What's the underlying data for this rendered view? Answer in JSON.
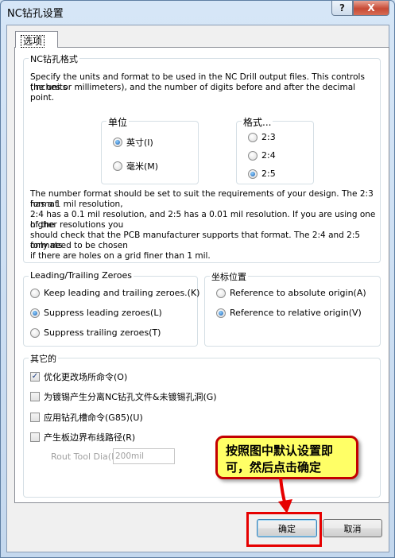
{
  "window": {
    "title": "NC钻孔设置"
  },
  "titlebar": {
    "help": "?",
    "close": "X"
  },
  "tabs": [
    {
      "label": "选项"
    }
  ],
  "format_group": {
    "title": "NC钻孔格式",
    "intro": [
      "Specify the units and format to be used in the NC Drill output files. This controls the units",
      "(inches or millimeters), and the number of digits before and after the decimal point."
    ],
    "units": {
      "title": "单位",
      "options": [
        {
          "label": "英寸(I)",
          "selected": true
        },
        {
          "label": "毫米(M)",
          "selected": false
        }
      ]
    },
    "format": {
      "title": "格式...",
      "options": [
        {
          "label": "2:3",
          "selected": false
        },
        {
          "label": "2:4",
          "selected": false
        },
        {
          "label": "2:5",
          "selected": true
        }
      ]
    },
    "note": [
      "The number format should be set to suit the requirements of your design. The 2:3 format",
      "has a 1 mil resolution,",
      "2:4 has a 0.1 mil resolution, and 2:5 has a 0.01 mil resolution. If you are using one of the",
      "higher resolutions you",
      "should check that the PCB manufacturer supports that format. The 2:4 and 2:5 formats",
      "only need to be chosen",
      "if there are holes on a grid finer than 1 mil."
    ]
  },
  "zeroes_group": {
    "title": "Leading/Trailing Zeroes",
    "options": [
      {
        "label": "Keep leading and trailing zeroes.(K)",
        "selected": false
      },
      {
        "label": "Suppress leading zeroes(L)",
        "selected": true
      },
      {
        "label": "Suppress trailing zeroes(T)",
        "selected": false
      }
    ]
  },
  "coord_group": {
    "title": "坐标位置",
    "options": [
      {
        "label": "Reference to absolute origin(A)",
        "selected": false
      },
      {
        "label": "Reference to relative origin(V)",
        "selected": true
      }
    ]
  },
  "other_group": {
    "title": "其它的",
    "checks": [
      {
        "label": "优化更改场所命令(O)",
        "checked": true
      },
      {
        "label": "为镀锡产生分离NC钻孔文件&未镀锡孔洞(G)",
        "checked": false
      },
      {
        "label": "应用钻孔槽命令(G85)(U)",
        "checked": false
      },
      {
        "label": "产生板边界布线路径(R)",
        "checked": false
      }
    ],
    "route_label": "Rout Tool  Dia(D",
    "route_value": "200mil"
  },
  "buttons": {
    "ok": "确定",
    "cancel": "取消"
  },
  "callout": {
    "text": "按照图中默认设置即可，然后点击确定"
  },
  "colors": {
    "callout_bg": "#ffff66",
    "callout_border": "#c30000",
    "highlight": "#e60000"
  }
}
